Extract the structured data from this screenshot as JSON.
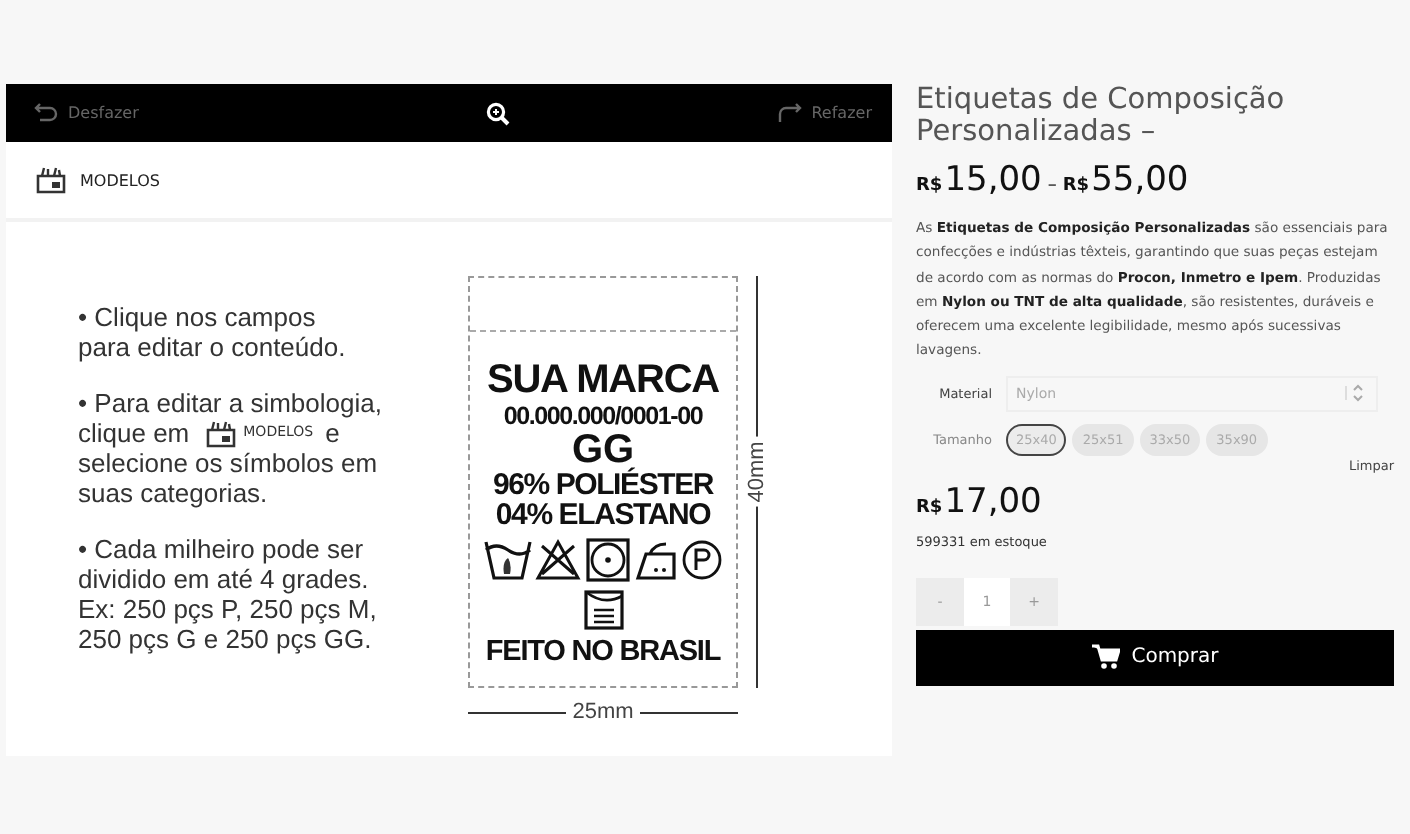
{
  "toolbar": {
    "undo": "Desfazer",
    "redo": "Refazer"
  },
  "models_button": "MODELOS",
  "instructions": [
    {
      "lines": [
        {
          "kind": "text",
          "text": "• Clique nos campos"
        },
        {
          "kind": "text",
          "text": "para editar o conteúdo."
        }
      ]
    },
    {
      "lines": [
        {
          "kind": "text",
          "text": "• Para editar a simbologia,"
        },
        {
          "kind": "chip",
          "before": "clique em",
          "chip": "MODELOS",
          "after": "e"
        },
        {
          "kind": "text",
          "text": "selecione os símbolos em"
        },
        {
          "kind": "text",
          "text": "suas categorias."
        }
      ]
    },
    {
      "lines": [
        {
          "kind": "text",
          "text": "• Cada milheiro pode ser"
        },
        {
          "kind": "text",
          "text": "dividido em até 4 grades."
        },
        {
          "kind": "text",
          "text": "Ex: 250 pçs P, 250 pçs M,"
        },
        {
          "kind": "text",
          "text": "250 pçs G e 250 pçs GG."
        }
      ]
    }
  ],
  "label": {
    "brand": "SUA MARCA",
    "cnpj": "00.000.000/0001-00",
    "size": "GG",
    "composition": [
      "96% POLIÉSTER",
      "04% ELASTANO"
    ],
    "origin": "FEITO NO BRASIL",
    "height": "40mm",
    "width": "25mm"
  },
  "product": {
    "title": "Etiquetas de Composição Personalizadas –",
    "price_range": [
      {
        "currency": "R$",
        "amount": "15,00"
      },
      {
        "currency": "R$",
        "amount": "55,00"
      }
    ],
    "range_separator": "–",
    "description": "As **Etiquetas de Composição Personalizadas** são essenciais para confecções e indústrias têxteis, garantindo que suas peças estejam de acordo com as normas do **Procon, Inmetro e Ipem**. Produzidas em **Nylon ou TNT de alta qualidade**, são resistentes, duráveis e oferecem uma excelente legibilidade, mesmo após sucessivas lavagens.",
    "material": {
      "label": "Material",
      "value": "Nylon"
    },
    "sizes": {
      "label": "Tamanho",
      "options": [
        {
          "label": "25x40",
          "selected": true
        },
        {
          "label": "25x51",
          "selected": false
        },
        {
          "label": "33x50",
          "selected": false
        },
        {
          "label": "35x90",
          "selected": false
        }
      ]
    },
    "clear": "Limpar",
    "price": {
      "currency": "R$",
      "amount": "17,00"
    },
    "stock": "599331 em estoque",
    "quantity": {
      "minus": "-",
      "value": "1",
      "plus": "+"
    },
    "buy": "Comprar"
  }
}
